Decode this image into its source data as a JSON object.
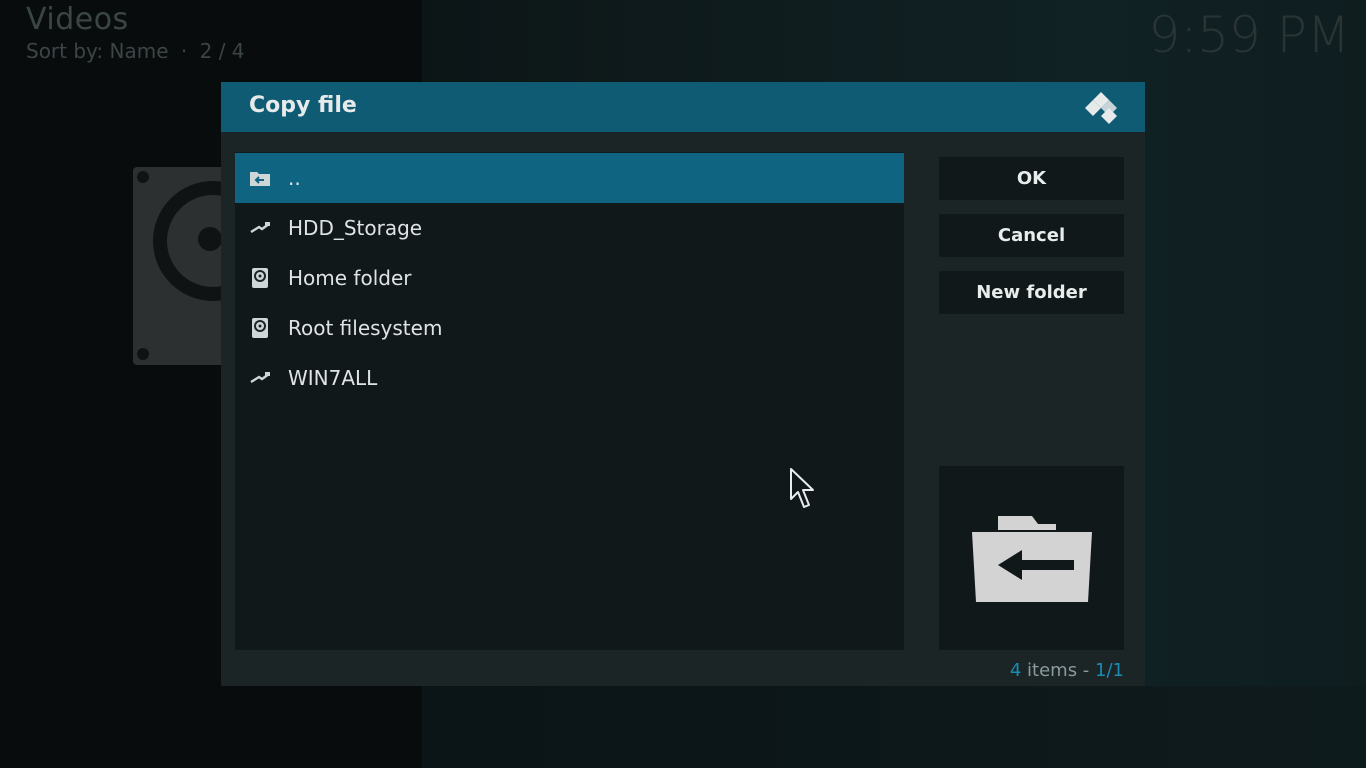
{
  "header": {
    "title": "Videos",
    "sort_label": "Sort by: Name",
    "sort_separator": "·",
    "position": "2 / 4"
  },
  "clock": "9:59 PM",
  "dialog": {
    "title": "Copy file",
    "logo_icon": "kodi-logo-icon",
    "items": [
      {
        "label": "..",
        "icon": "folder-back-icon",
        "selected": true
      },
      {
        "label": "HDD_Storage",
        "icon": "usb-icon",
        "selected": false
      },
      {
        "label": "Home folder",
        "icon": "hard-drive-icon",
        "selected": false
      },
      {
        "label": "Root filesystem",
        "icon": "hard-drive-icon",
        "selected": false
      },
      {
        "label": "WIN7ALL",
        "icon": "usb-icon",
        "selected": false
      }
    ],
    "buttons": {
      "ok": "OK",
      "cancel": "Cancel",
      "new_folder": "New folder"
    },
    "preview_icon": "folder-back-icon",
    "footer": {
      "count": "4",
      "count_suffix": "items -",
      "page": "1/1"
    }
  },
  "colors": {
    "accent": "#0f6482",
    "header": "#0f5b74",
    "count_accent": "#1a8bb5"
  }
}
